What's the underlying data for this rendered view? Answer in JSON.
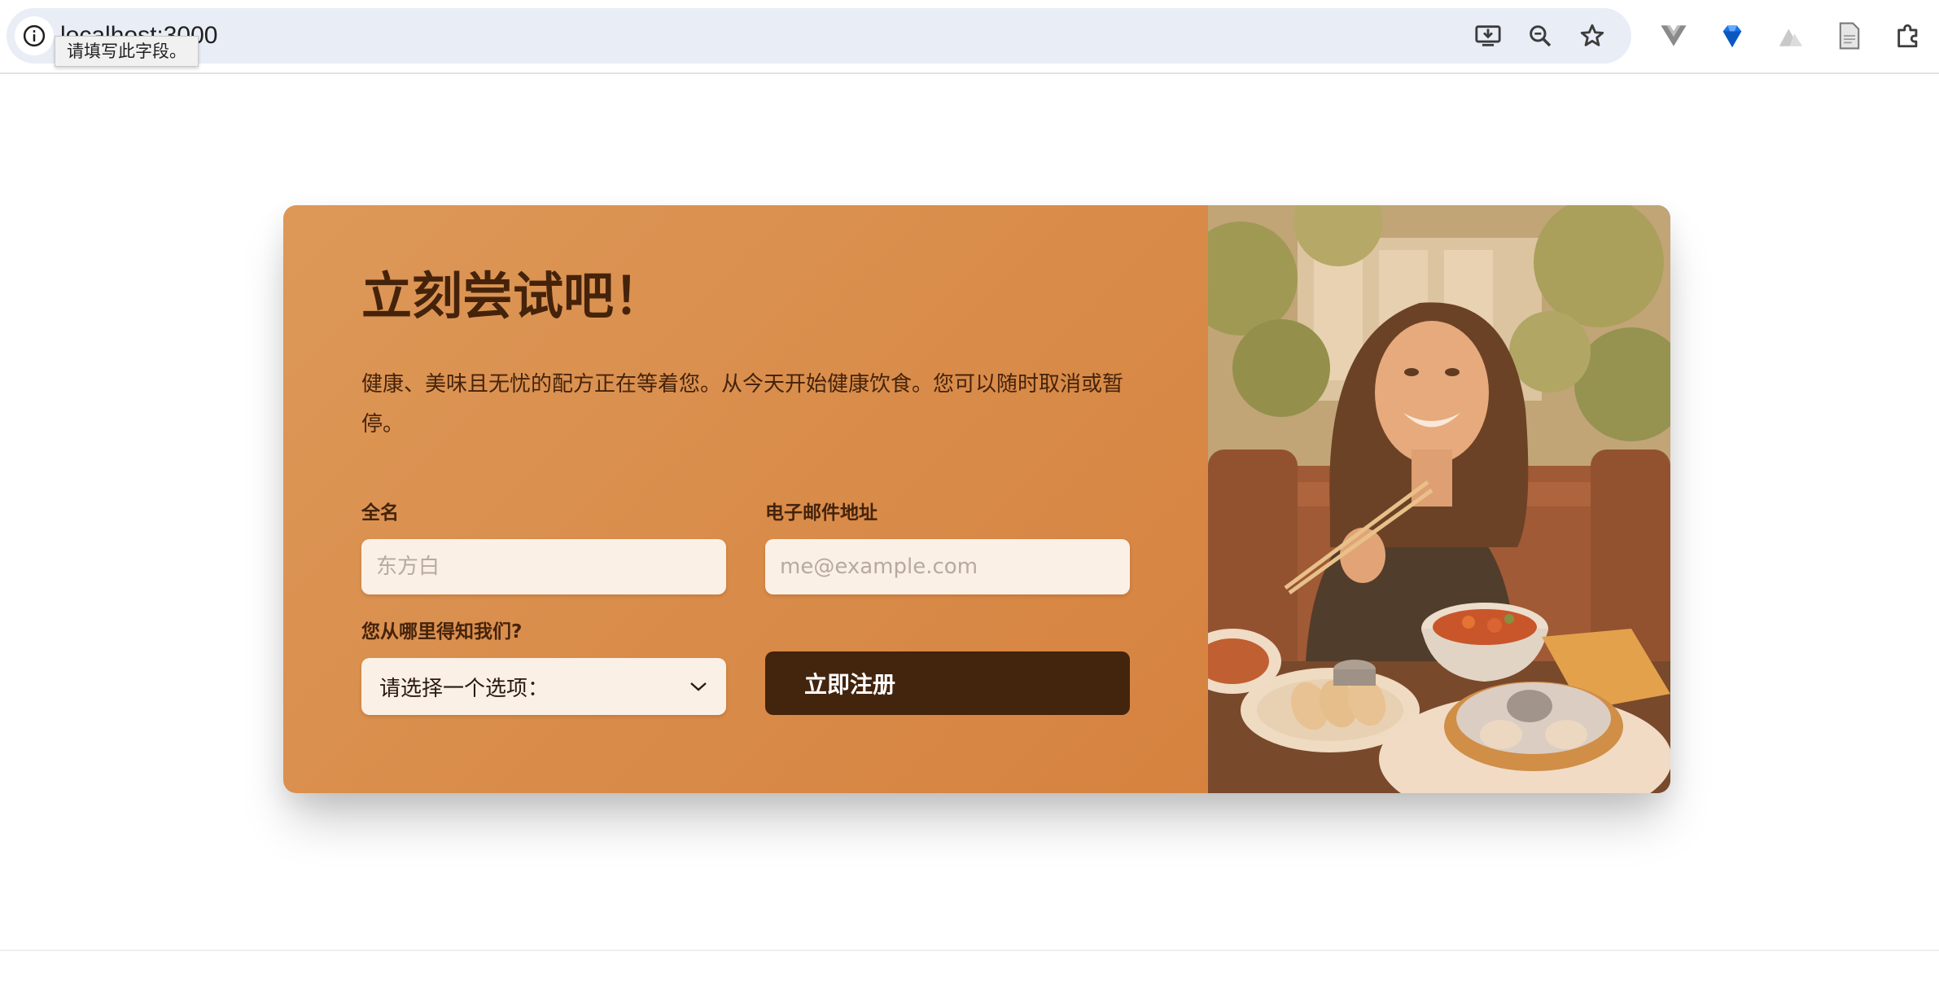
{
  "browser": {
    "url": "localhost:3000",
    "tooltip": "请填写此字段。",
    "icons": [
      "info-icon",
      "install-app-icon",
      "zoom-out-icon",
      "bookmark-star-icon",
      "vue-devtools-icon",
      "sapphire-extension-icon",
      "nuxt-extension-icon",
      "page-icon",
      "extensions-puzzle-icon"
    ]
  },
  "form": {
    "heading": "立刻尝试吧！",
    "description": "健康、美味且无忧的配方正在等着您。从今天开始健康饮食。您可以随时取消或暂停。",
    "name_label": "全名",
    "name_placeholder": "东方白",
    "email_label": "电子邮件地址",
    "email_placeholder": "me@example.com",
    "source_label": "您从哪里得知我们?",
    "source_selected": "请选择一个选项：",
    "submit_label": "立即注册"
  },
  "image": {
    "description_icon": "woman-eating-dumplings-photo"
  },
  "colors": {
    "accent": "#d98c4a",
    "dark_brown": "#43240d",
    "input_bg": "#fbf0e6"
  }
}
